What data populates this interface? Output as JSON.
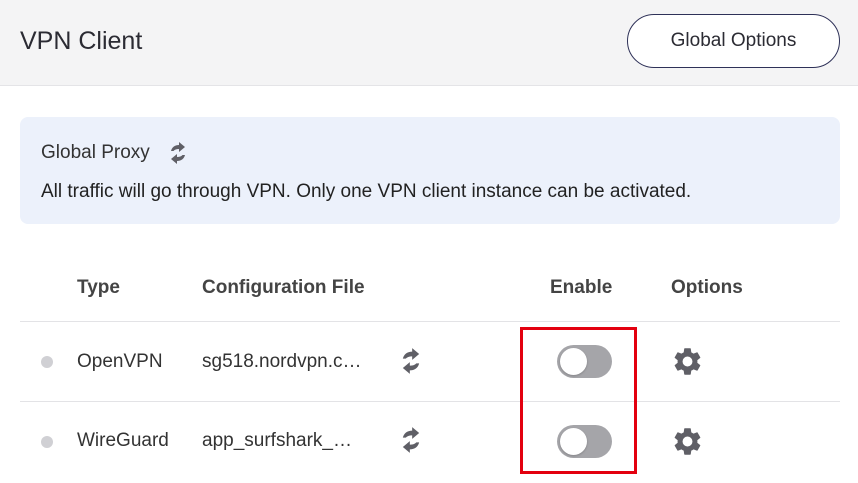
{
  "header": {
    "title": "VPN Client",
    "global_options_label": "Global Options"
  },
  "proxy": {
    "title": "Global Proxy",
    "switch_icon": "switch-arrows-icon",
    "description": "All traffic will go through VPN. Only one VPN client instance can be activated."
  },
  "table": {
    "columns": [
      "Type",
      "Configuration File",
      "Enable",
      "Options"
    ],
    "rows": [
      {
        "status": "inactive",
        "type": "OpenVPN",
        "config_file": "sg518.nordvpn.c…",
        "enabled": false,
        "options_icon": "gear-icon"
      },
      {
        "status": "inactive",
        "type": "WireGuard",
        "config_file": "app_surfshark_…",
        "enabled": false,
        "options_icon": "gear-icon"
      }
    ]
  },
  "colors": {
    "header_bg": "#f4f4f5",
    "proxy_bg": "#ecf1fb",
    "toggle_off": "#a5a5a9",
    "icon_gray": "#5f5f66",
    "highlight": "#e3000f"
  }
}
